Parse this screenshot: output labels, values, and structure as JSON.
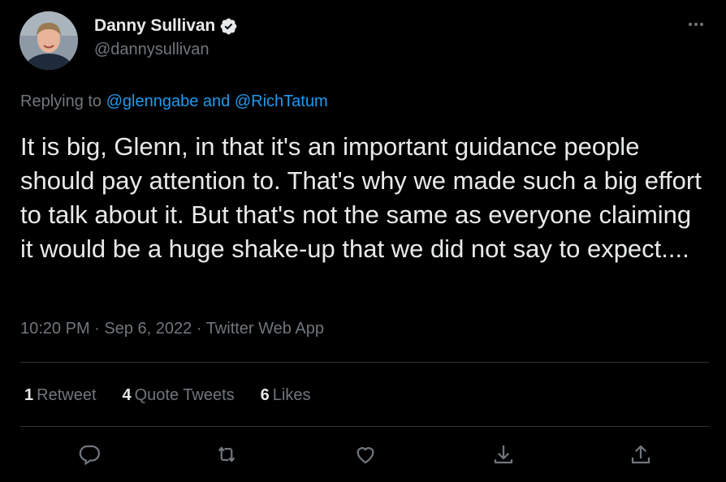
{
  "author": {
    "display_name": "Danny Sullivan",
    "handle": "@dannysullivan",
    "verified_icon": "verified-badge-icon",
    "avatar_icon": "profile-photo"
  },
  "reply": {
    "prefix": "Replying to ",
    "mentions": "@glenngabe and @RichTatum"
  },
  "tweet": {
    "text": "It is big, Glenn, in that it's an important guidance people should pay attention to. That's why we made such a big effort to talk about it. But that's not the same as everyone claiming it would be a huge shake-up that we did not say to expect....",
    "time": "10:20 PM",
    "date": "Sep 6, 2022",
    "source": "Twitter Web App",
    "separator": " · "
  },
  "stats": [
    {
      "count": "1",
      "label": "Retweet"
    },
    {
      "count": "4",
      "label": "Quote Tweets"
    },
    {
      "count": "6",
      "label": "Likes"
    }
  ],
  "actions": [
    "reply-icon",
    "retweet-icon",
    "like-icon",
    "bookmark-icon",
    "share-icon"
  ],
  "colors": {
    "background": "#000000",
    "text": "#e7e9ea",
    "muted": "#71767b",
    "link": "#1d9bf0",
    "divider": "#2f3336"
  }
}
